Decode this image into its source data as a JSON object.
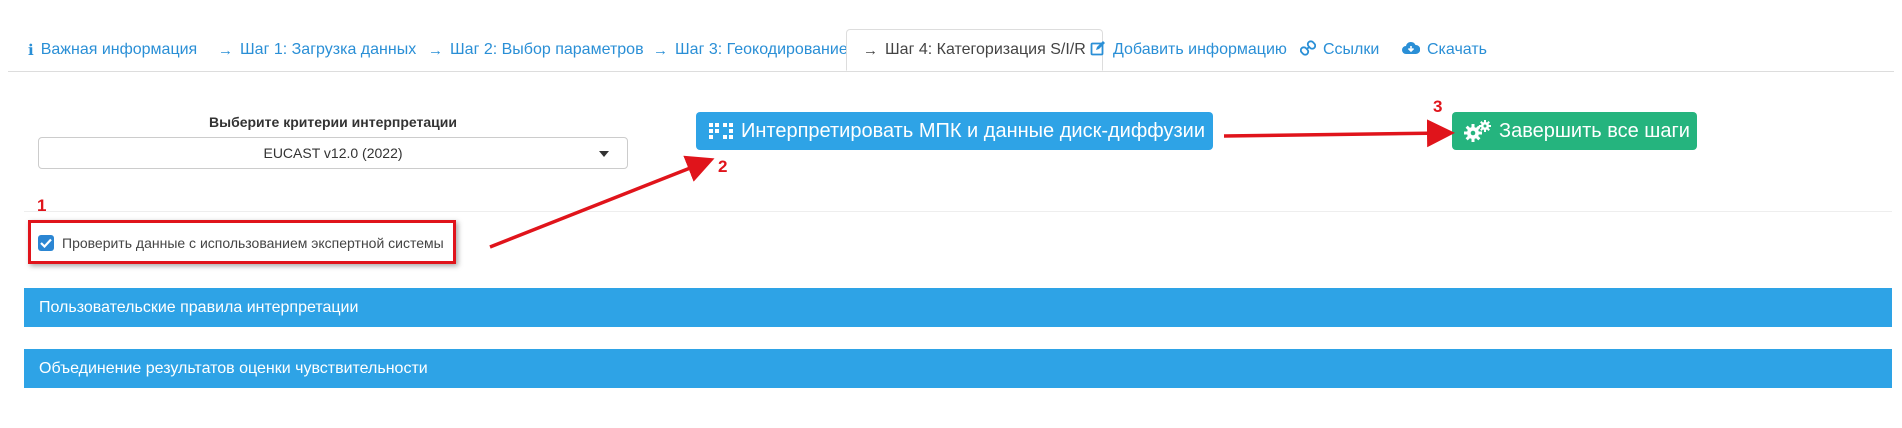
{
  "tabs": [
    {
      "label": "Важная информация",
      "icon": "info-icon"
    },
    {
      "label": "Шаг 1: Загрузка данных",
      "icon": "arrow-right-icon"
    },
    {
      "label": "Шаг 2: Выбор параметров",
      "icon": "arrow-right-icon"
    },
    {
      "label": "Шаг 3: Геокодирование",
      "icon": "arrow-right-icon"
    },
    {
      "label": "Шаг 4: Категоризация S/I/R",
      "icon": "arrow-right-icon",
      "active": true
    },
    {
      "label": "Добавить информацию",
      "icon": "edit-icon"
    },
    {
      "label": "Ссылки",
      "icon": "link-icon"
    },
    {
      "label": "Скачать",
      "icon": "cloud-download-icon"
    }
  ],
  "criteria": {
    "label": "Выберите критерии интерпретации",
    "selected": "EUCAST v12.0 (2022)"
  },
  "buttons": {
    "interpret": "Интерпретировать МПК и данные диск-диффузии",
    "finish": "Завершить все шаги"
  },
  "expert_check": {
    "label": "Проверить данные с использованием экспертной системы",
    "checked": true
  },
  "panels": {
    "custom_rules": "Пользовательские правила интерпретации",
    "merge_results": "Объединение результатов оценки чувствительности"
  },
  "annotations": {
    "n1": "1",
    "n2": "2",
    "n3": "3"
  },
  "colors": {
    "link": "#2a8fd6",
    "primary": "#2ea3e6",
    "success": "#25b47e",
    "annotation": "#e0141b"
  }
}
